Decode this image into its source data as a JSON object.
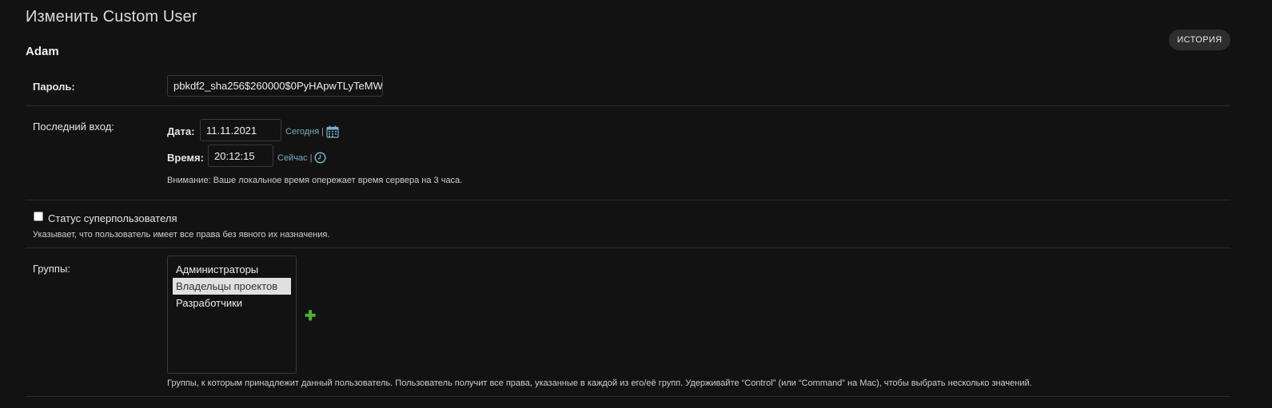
{
  "header": {
    "title": "Изменить Custom User",
    "history_label": "ИСТОРИЯ",
    "object_name": "Adam"
  },
  "password": {
    "label": "Пароль:",
    "value": "pbkdf2_sha256$260000$0PyHApwTLyTeMW"
  },
  "last_login": {
    "label": "Последний вход:",
    "date_label": "Дата:",
    "date_value": "11.11.2021",
    "today_link": "Сегодня",
    "separator": "|",
    "calendar_icon": "calendar-icon",
    "time_label": "Время:",
    "time_value": "20:12:15",
    "now_link": "Сейчас",
    "clock_icon": "clock-icon",
    "warning": "Внимание: Ваше локальное время опережает время сервера на 3 часа."
  },
  "superuser": {
    "checked": false,
    "label": "Статус суперпользователя",
    "help": "Указывает, что пользователь имеет все права без явного их назначения."
  },
  "groups": {
    "label": "Группы:",
    "options": [
      {
        "label": "Администраторы",
        "selected": false
      },
      {
        "label": "Владельцы проектов",
        "selected": true
      },
      {
        "label": "Разработчики",
        "selected": false
      }
    ],
    "add_icon": "plus-icon",
    "add_symbol": "✚",
    "help": "Группы, к которым принадлежит данный пользователь. Пользователь получит все права, указанные в каждой из его/её групп. Удерживайте “Control” (или “Command” на Mac), чтобы выбрать несколько значений."
  },
  "colors": {
    "background": "#121212",
    "link": "#79aec8",
    "add": "#4caf3a",
    "divider": "#2c2c2c"
  }
}
